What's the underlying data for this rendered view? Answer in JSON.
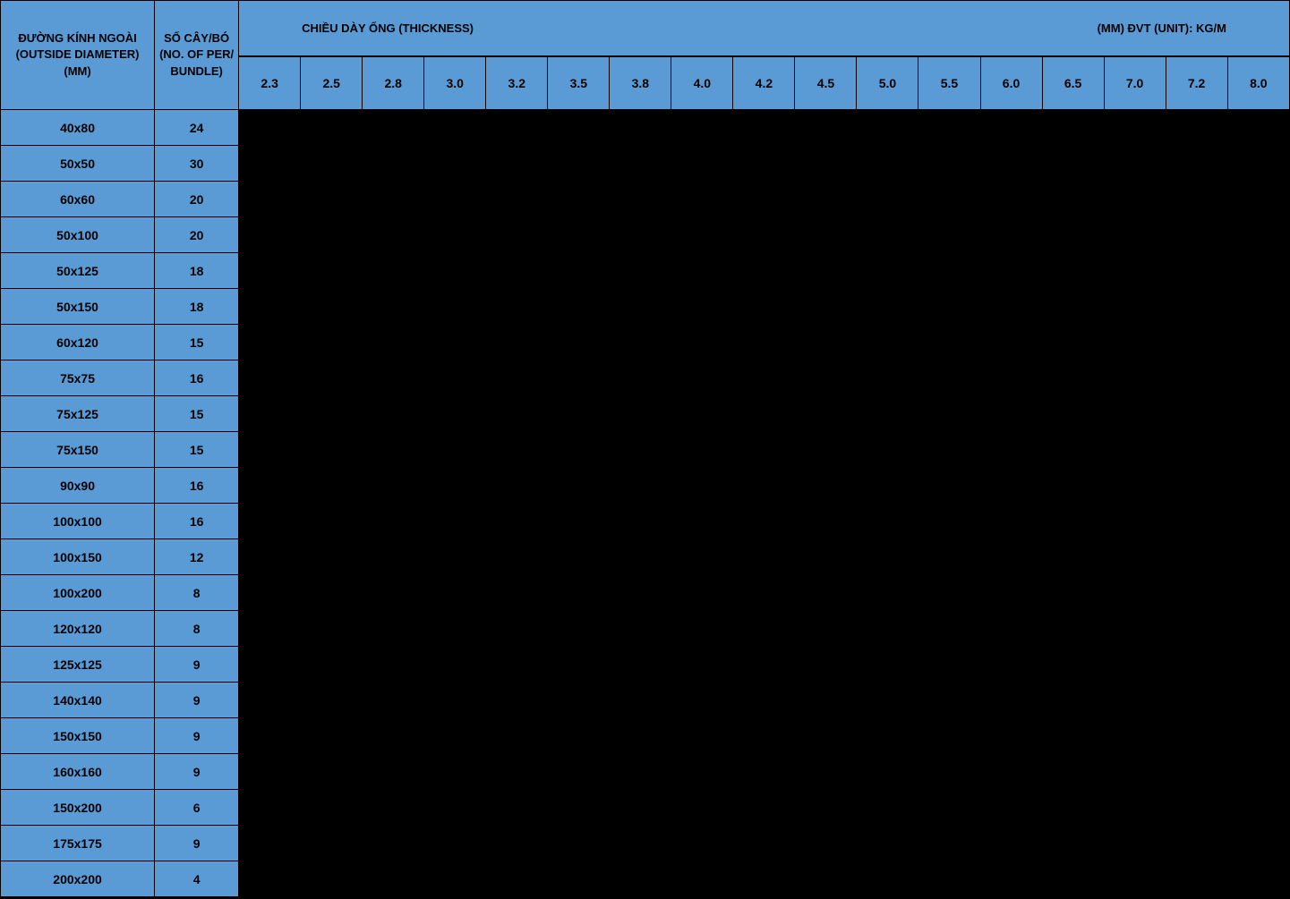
{
  "headers": {
    "od": "ĐƯỜNG KÍNH NGOÀI (OUTSIDE DIAMETER) (MM)",
    "bundle": "SỐ CÂY/BÓ (NO. OF PER/ BUNDLE)",
    "thickness_title": "CHIỀU DÀY ỐNG (THICKNESS)",
    "unit": "(MM) ĐVT (UNIT): KG/M",
    "thickness_values": [
      "2.3",
      "2.5",
      "2.8",
      "3.0",
      "3.2",
      "3.5",
      "3.8",
      "4.0",
      "4.2",
      "4.5",
      "5.0",
      "5.5",
      "6.0",
      "6.5",
      "7.0",
      "7.2",
      "8.0"
    ]
  },
  "rows": [
    {
      "od": "40x80",
      "bundle": "24"
    },
    {
      "od": "50x50",
      "bundle": "30"
    },
    {
      "od": "60x60",
      "bundle": "20"
    },
    {
      "od": "50x100",
      "bundle": "20"
    },
    {
      "od": "50x125",
      "bundle": "18"
    },
    {
      "od": "50x150",
      "bundle": "18"
    },
    {
      "od": "60x120",
      "bundle": "15"
    },
    {
      "od": "75x75",
      "bundle": "16"
    },
    {
      "od": "75x125",
      "bundle": "15"
    },
    {
      "od": "75x150",
      "bundle": "15"
    },
    {
      "od": "90x90",
      "bundle": "16"
    },
    {
      "od": "100x100",
      "bundle": "16"
    },
    {
      "od": "100x150",
      "bundle": "12"
    },
    {
      "od": "100x200",
      "bundle": "8"
    },
    {
      "od": "120x120",
      "bundle": "8"
    },
    {
      "od": "125x125",
      "bundle": "9"
    },
    {
      "od": "140x140",
      "bundle": "9"
    },
    {
      "od": "150x150",
      "bundle": "9"
    },
    {
      "od": "160x160",
      "bundle": "9"
    },
    {
      "od": "150x200",
      "bundle": "6"
    },
    {
      "od": "175x175",
      "bundle": "9"
    },
    {
      "od": "200x200",
      "bundle": "4"
    }
  ]
}
